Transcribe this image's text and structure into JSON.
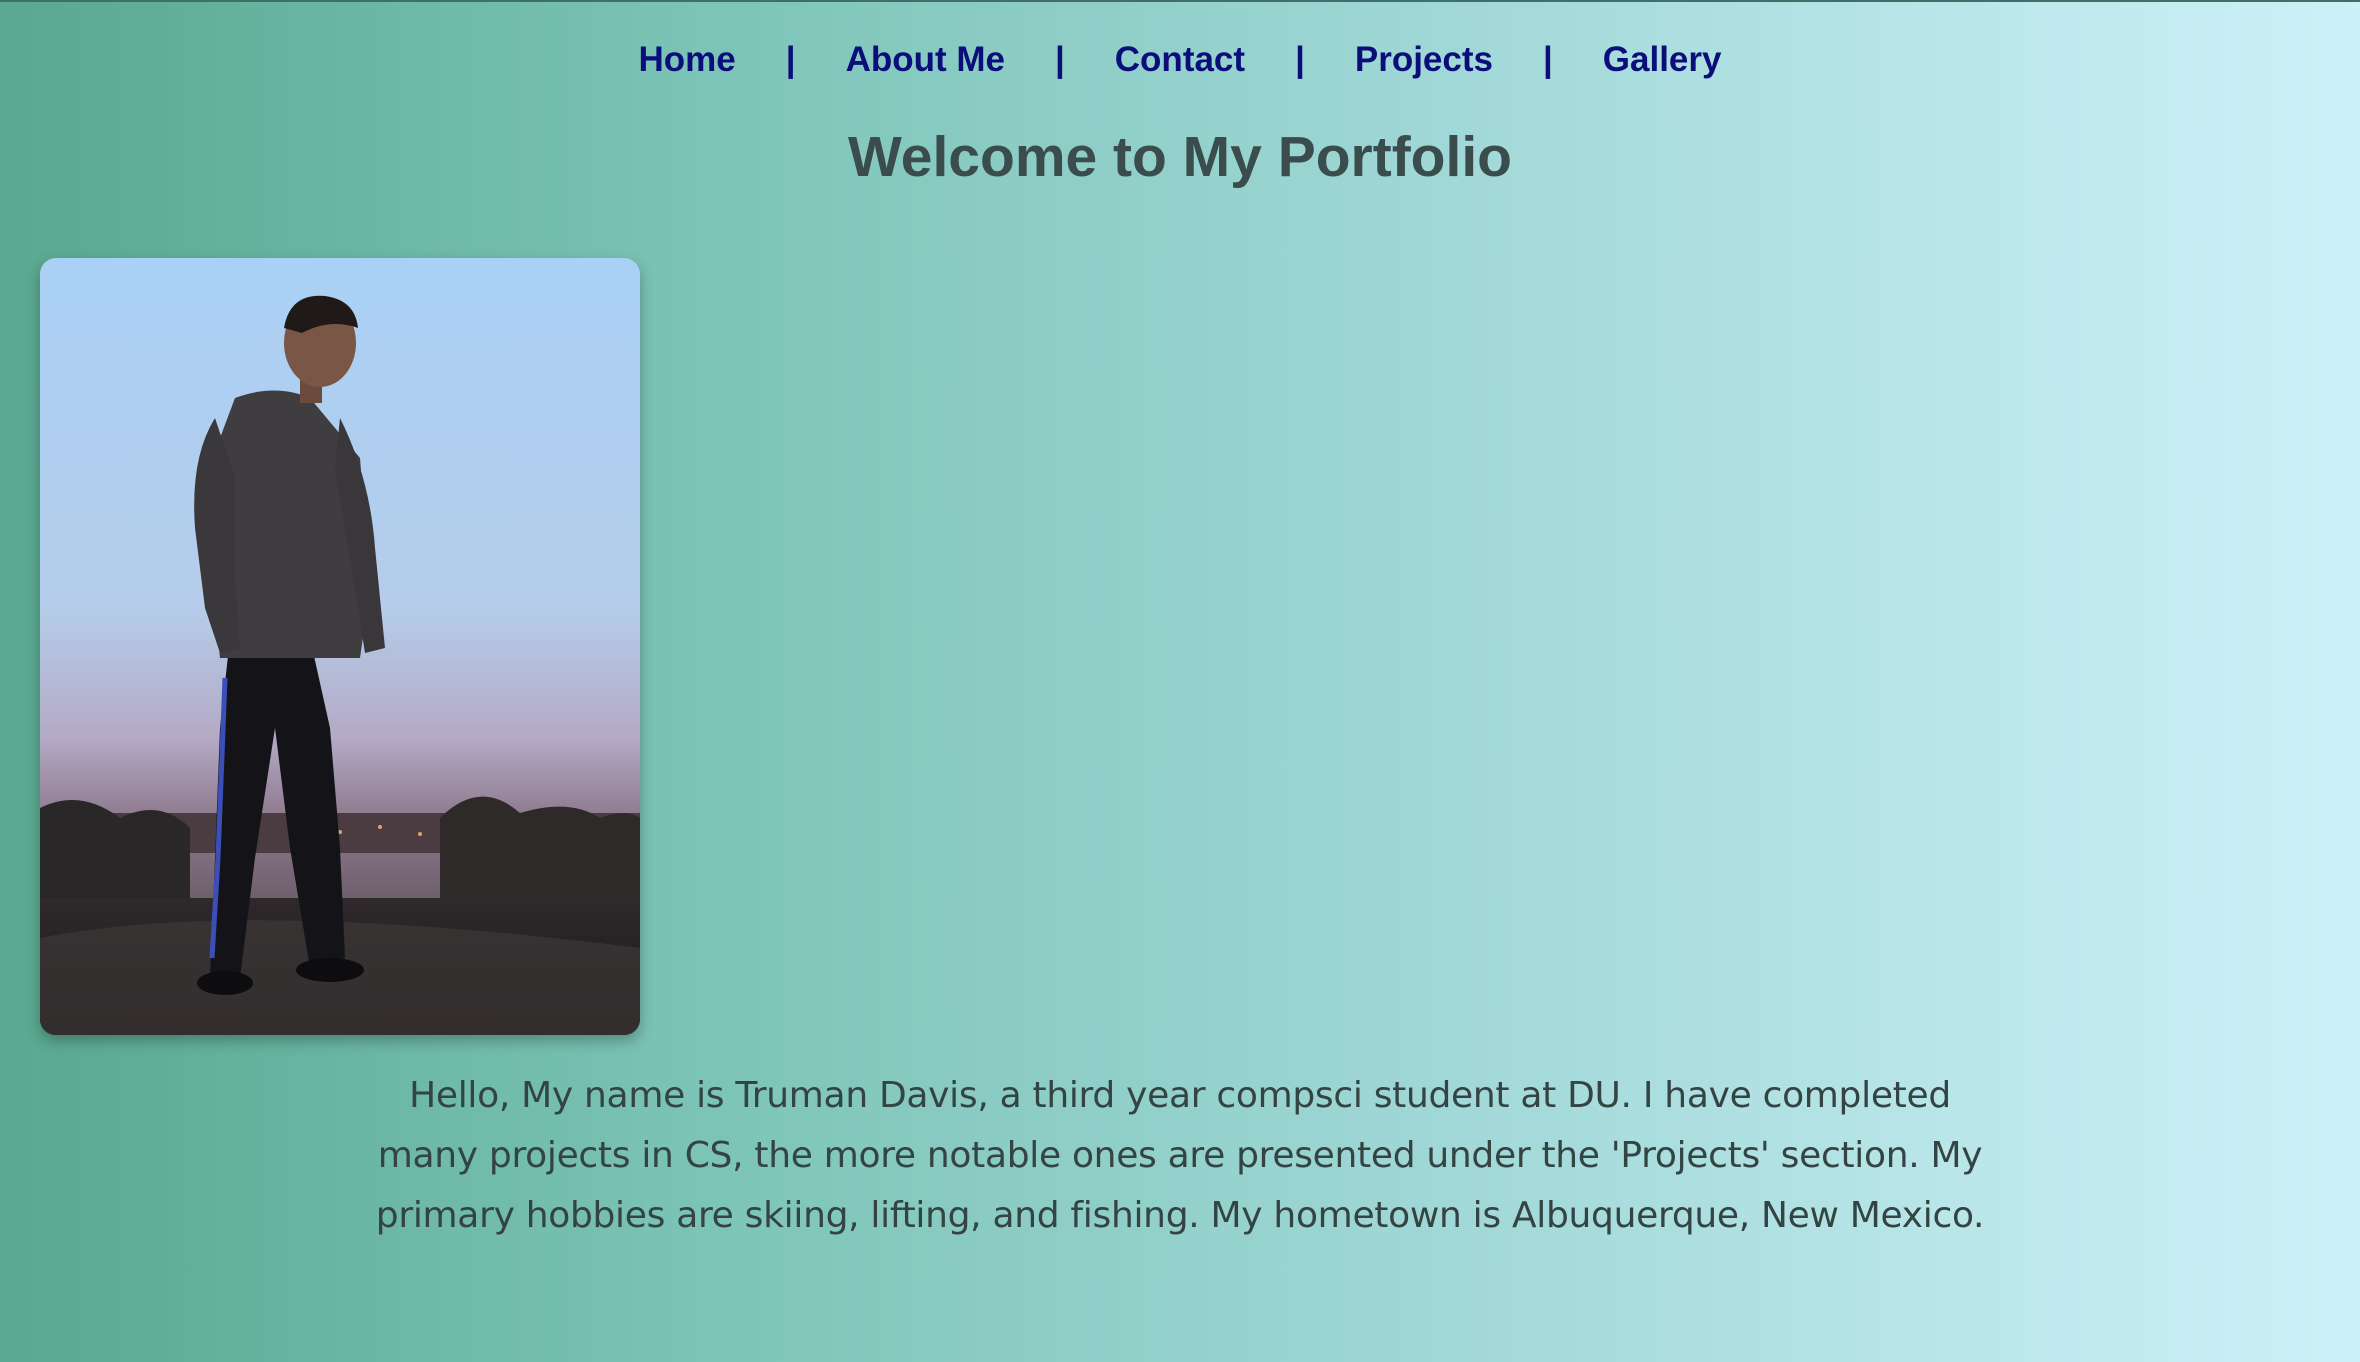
{
  "nav": {
    "items": [
      {
        "label": "Home"
      },
      {
        "label": "About Me"
      },
      {
        "label": "Contact"
      },
      {
        "label": "Projects"
      },
      {
        "label": "Gallery"
      }
    ],
    "separator": "|"
  },
  "header": {
    "title": "Welcome to My Portfolio"
  },
  "profile_photo": {
    "icon": "person-standing-on-hill-at-dusk"
  },
  "bio": {
    "text": "Hello, My name is Truman Davis, a third year compsci student at DU. I have completed many projects in CS, the more notable ones are presented under the 'Projects' section. My primary hobbies are skiing, lifting, and fishing. My hometown is Albuquerque, New Mexico."
  },
  "colors": {
    "nav_link": "#0b0d7a",
    "title": "#3a4d4c",
    "bio_text": "#334443",
    "gradient_left": "#59a88f",
    "gradient_right": "#cdf1f8"
  }
}
